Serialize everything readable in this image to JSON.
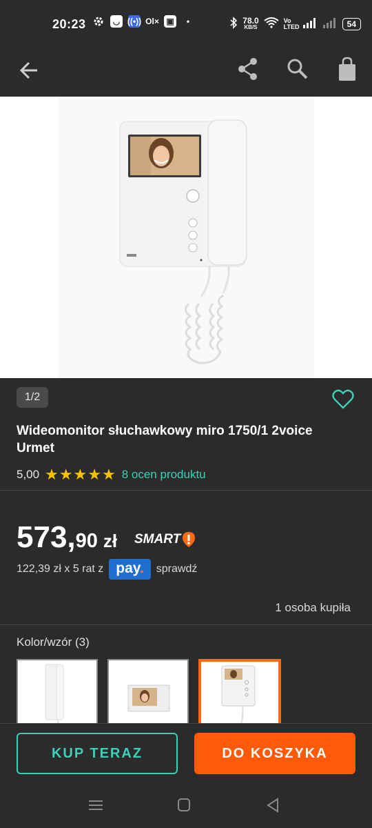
{
  "status_bar": {
    "time": "20:23",
    "network_speed": "78.0",
    "network_unit": "KB/S",
    "volte": "Vo LTED",
    "battery": "54"
  },
  "app_bar": {
    "back_icon": "arrow-left-icon",
    "share_icon": "share-icon",
    "search_icon": "search-icon",
    "cart_icon": "shopping-bag-icon"
  },
  "product": {
    "gallery_position": "1/2",
    "title": "Wideomonitor słuchawkowy miro 1750/1 2voice Urmet",
    "rating_score": "5,00",
    "rating_stars": 5,
    "rating_stars_text": "★★★★★",
    "reviews_text": "8 ocen produktu",
    "price_int": "573,",
    "price_dec": "90",
    "currency": "zł",
    "smart_label": "SMART",
    "installments_text": "122,39 zł x 5 rat z",
    "pay_label": "pay",
    "pay_dot": ".",
    "check_label": "sprawdź",
    "bought_text": "1 osoba kupiła",
    "variants_label": "Kolor/wzór (3)"
  },
  "actions": {
    "buy_now": "KUP TERAZ",
    "add_to_cart": "DO KOSZYKA"
  },
  "colors": {
    "background": "#2b2b2b",
    "accent_teal": "#3bd1b4",
    "accent_orange": "#ff5a0a",
    "star": "#f6c200",
    "pay_blue": "#1f6fd1"
  }
}
